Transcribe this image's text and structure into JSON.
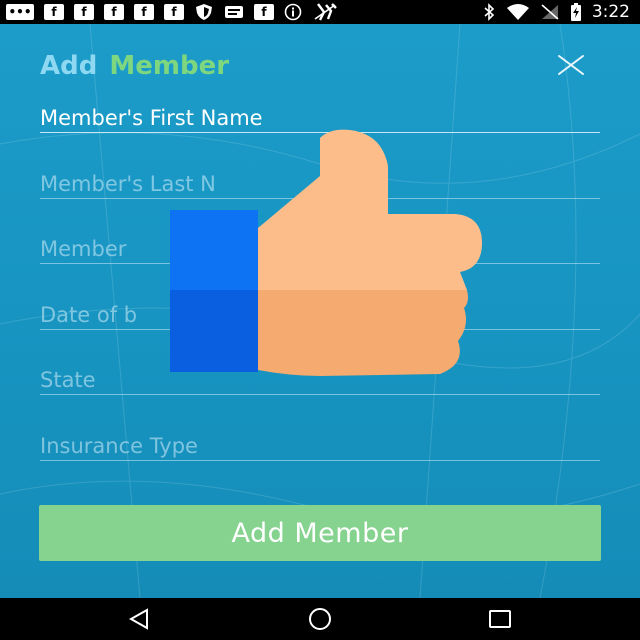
{
  "status_bar": {
    "time": "3:22",
    "left_icons": [
      "more-icon",
      "facebook-icon",
      "facebook-icon",
      "facebook-icon",
      "facebook-icon",
      "facebook-icon",
      "shield-icon",
      "message-icon",
      "facebook-icon",
      "info-icon",
      "no-location-icon"
    ],
    "right_icons": [
      "bluetooth-icon",
      "wifi-icon",
      "no-sim-icon",
      "battery-charging-icon"
    ]
  },
  "header": {
    "title_part1": "Add",
    "title_part2": "Member",
    "title_color1": "#8fd8f2",
    "title_color2": "#7ed77e",
    "close_icon": "close-icon"
  },
  "form": {
    "fields": [
      {
        "label": "Member's First Name",
        "state": "filled"
      },
      {
        "label": "Member's Last N",
        "state": "placeholder"
      },
      {
        "label": "Member",
        "state": "placeholder"
      },
      {
        "label": "Date of b",
        "state": "placeholder"
      },
      {
        "label": "State",
        "state": "placeholder"
      },
      {
        "label": "Insurance Type",
        "state": "placeholder"
      }
    ],
    "submit_label": "Add Member",
    "submit_color": "#86d28f"
  },
  "overlay": {
    "icon": "thumbs-up-icon"
  },
  "nav_bar": {
    "buttons": [
      "back-icon",
      "home-icon",
      "recents-icon"
    ]
  },
  "colors": {
    "background": "#1a96c4",
    "status_bar": "#000000",
    "nav_bar": "#000000"
  }
}
